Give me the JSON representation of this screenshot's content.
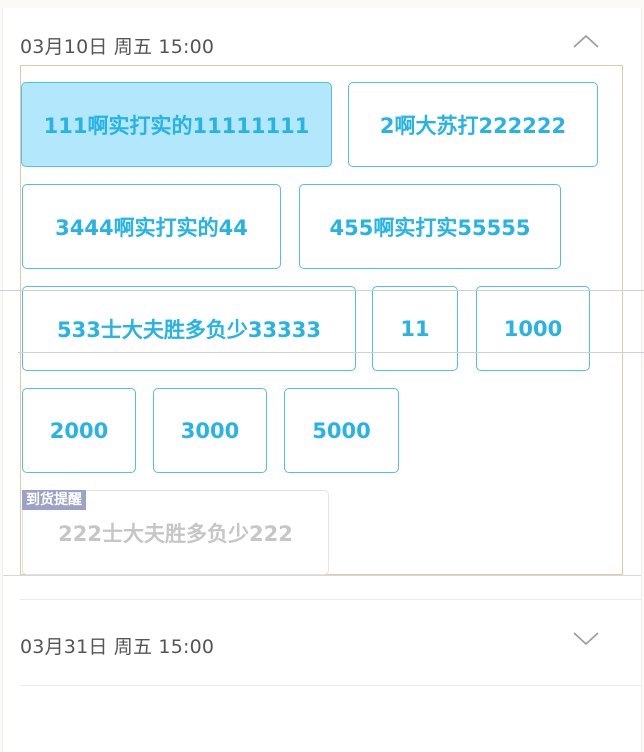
{
  "sessions": [
    {
      "date": "03月10日 周五 15:00",
      "expanded": true,
      "options": [
        {
          "label": "111啊实打实的11111111",
          "state": "selected"
        },
        {
          "label": "2啊大苏打222222",
          "state": "normal"
        },
        {
          "label": "3444啊实打实的44",
          "state": "normal"
        },
        {
          "label": "455啊实打实55555",
          "state": "normal"
        },
        {
          "label": "533士大夫胜多负少33333",
          "state": "normal"
        },
        {
          "label": "11",
          "state": "normal"
        },
        {
          "label": "1000",
          "state": "normal"
        },
        {
          "label": "2000",
          "state": "normal"
        },
        {
          "label": "3000",
          "state": "normal"
        },
        {
          "label": "5000",
          "state": "normal"
        },
        {
          "label": "222士大夫胜多负少222",
          "state": "disabled",
          "badge": "到货提醒"
        }
      ]
    },
    {
      "date": "03月31日 周五 15:00",
      "expanded": false
    }
  ],
  "icons": {
    "expanded": "chevron-up-icon",
    "collapsed": "chevron-down-icon"
  },
  "colors": {
    "accent": "#27b3e4",
    "selected_bg": "#b3e7fb",
    "disabled_text": "#c6c6c6",
    "badge_bg": "#9aa3c7"
  }
}
